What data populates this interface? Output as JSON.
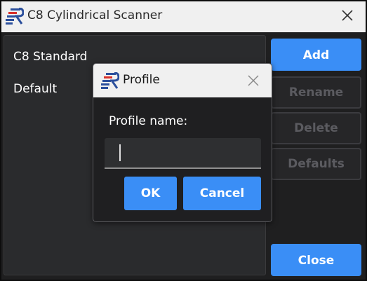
{
  "window": {
    "title": "C8 Cylindrical Scanner"
  },
  "profiles": {
    "items": [
      {
        "label": "C8 Standard"
      },
      {
        "label": "Default"
      }
    ]
  },
  "sidebar": {
    "add_label": "Add",
    "rename_label": "Rename",
    "delete_label": "Delete",
    "defaults_label": "Defaults",
    "close_label": "Close"
  },
  "dialog": {
    "title": "Profile",
    "field_label": "Profile name:",
    "input_value": "",
    "ok_label": "OK",
    "cancel_label": "Cancel"
  },
  "icons": {
    "app_logo": "cr-logo-icon",
    "window_close": "close-icon",
    "dialog_close": "close-icon"
  },
  "colors": {
    "accent": "#3a8ef6",
    "background": "#1f1f20",
    "panel": "#2a2b2d",
    "titlebar": "#f0f0f0",
    "logo_blue": "#2b4f9c",
    "logo_red": "#d9302a",
    "disabled_text": "#5b5b60"
  }
}
